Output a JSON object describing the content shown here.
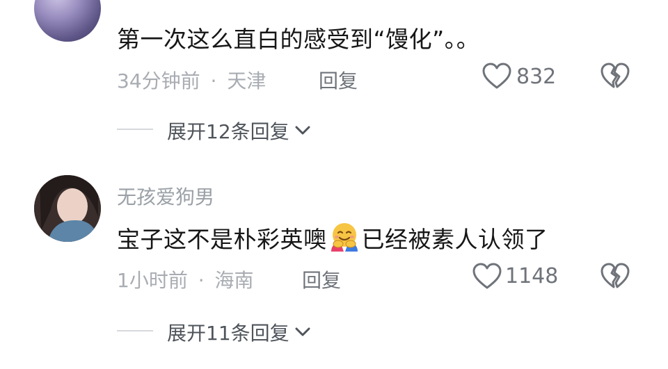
{
  "comments": [
    {
      "username": "",
      "text": "第一次这么直白的感受到“馒化”。。",
      "time": "34分钟前",
      "separator": "·",
      "location": "天津",
      "reply_label": "回复",
      "like_count": "832",
      "expand_label": "展开12条回复"
    },
    {
      "username": "无孩爱狗男",
      "text_before_emoji": "宝子这不是朴彩英噢",
      "emoji": "hugging-face-emoji",
      "text_after_emoji": "已经被素人认领了",
      "time": "1小时前",
      "separator": "·",
      "location": "海南",
      "reply_label": "回复",
      "like_count": "1148",
      "expand_label": "展开11条回复"
    }
  ],
  "icons": {
    "like": "heart-outline-icon",
    "dislike": "broken-heart-icon",
    "expand": "chevron-down-icon"
  },
  "colors": {
    "primary_text": "#161616",
    "secondary_text": "#a8acb2",
    "action_text": "#6f737a",
    "divider": "#d6d8dc"
  }
}
